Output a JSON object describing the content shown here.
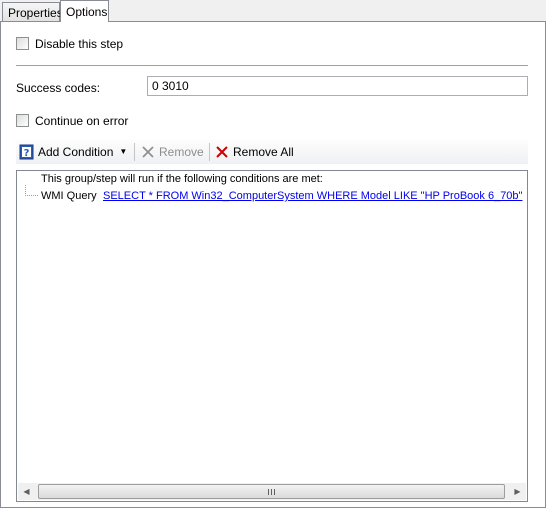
{
  "tabs": [
    {
      "label": "Properties"
    },
    {
      "label": "Options"
    }
  ],
  "disable_step": {
    "label": "Disable this step",
    "checked": false
  },
  "success_codes": {
    "label": "Success codes:",
    "value": "0 3010"
  },
  "continue_on_error": {
    "label": "Continue on error",
    "checked": false
  },
  "toolbar": {
    "add_condition": "Add Condition",
    "remove": "Remove",
    "remove_all": "Remove All"
  },
  "conditions": {
    "header": "This group/step will run if the following conditions are met:",
    "items": [
      {
        "type": "WMI Query",
        "value": "SELECT * FROM Win32_ComputerSystem WHERE Model LIKE \"HP ProBook 6_70b\""
      }
    ]
  },
  "icons": {
    "add_condition": "help-question-icon",
    "remove": "x-icon",
    "remove_all": "red-x-icon"
  },
  "colors": {
    "link": "#0000ee",
    "remove_all_x": "#cc0000"
  }
}
